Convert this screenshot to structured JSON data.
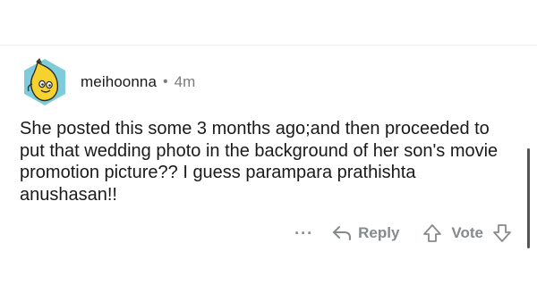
{
  "comment": {
    "username": "meihoonna",
    "separator": "•",
    "timestamp": "4m",
    "text": "She posted this some 3 months ago;and then proceeded to put that wedding photo in the background of her son's movie promotion picture?? I guess parampara prathishta anushasan!!",
    "avatar_icon": "banana-snoo-avatar-icon"
  },
  "actions": {
    "more_label": "···",
    "reply_label": "Reply",
    "vote_label": "Vote",
    "reply_icon": "reply-arrow-icon",
    "upvote_icon": "upvote-arrow-icon",
    "downvote_icon": "downvote-arrow-icon"
  },
  "colors": {
    "text": "#1a1a1b",
    "meta": "#7c7c7c",
    "action": "#878a8c",
    "avatar_bg": "#7ecbd9",
    "banana": "#f6d22e"
  }
}
